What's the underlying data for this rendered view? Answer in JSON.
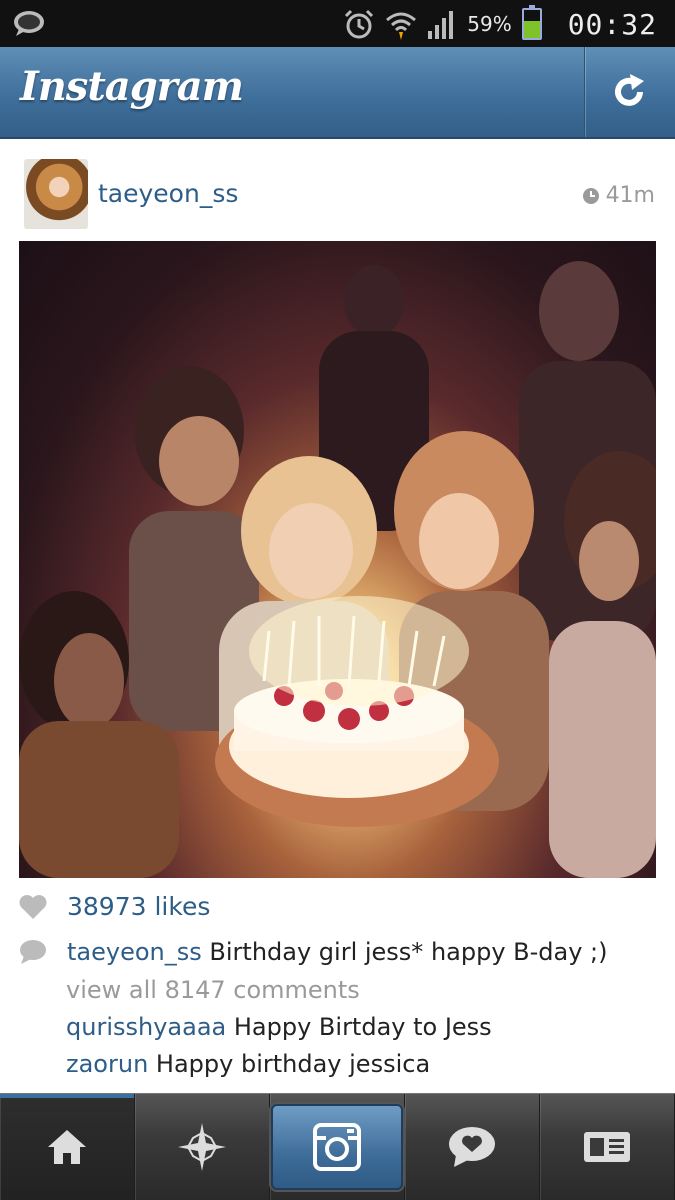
{
  "status_bar": {
    "battery_percent": "59%",
    "battery_level": 0.59,
    "time": "00:32"
  },
  "header": {
    "app_title": "Instagram"
  },
  "post": {
    "username": "taeyeon_ss",
    "time_ago": "41m",
    "likes": "38973 likes",
    "caption_username": "taeyeon_ss",
    "caption_text": "Birthday girl jess* happy B-day ;)",
    "view_all_comments": "view all 8147 comments",
    "comments": [
      {
        "username": "qurisshyaaaa",
        "text": "Happy Birtday to Jess"
      },
      {
        "username": "zaorun",
        "text": "Happy birthday jessica"
      }
    ]
  },
  "bottom_nav": {
    "items": [
      "home-icon",
      "explore-icon",
      "camera-icon",
      "news-icon",
      "profile-icon"
    ],
    "active": "home-icon"
  },
  "colors": {
    "accent": "#3f6f9b",
    "link": "#2d5d88",
    "muted": "#9a9a9a",
    "battery": "#7ec32a"
  }
}
